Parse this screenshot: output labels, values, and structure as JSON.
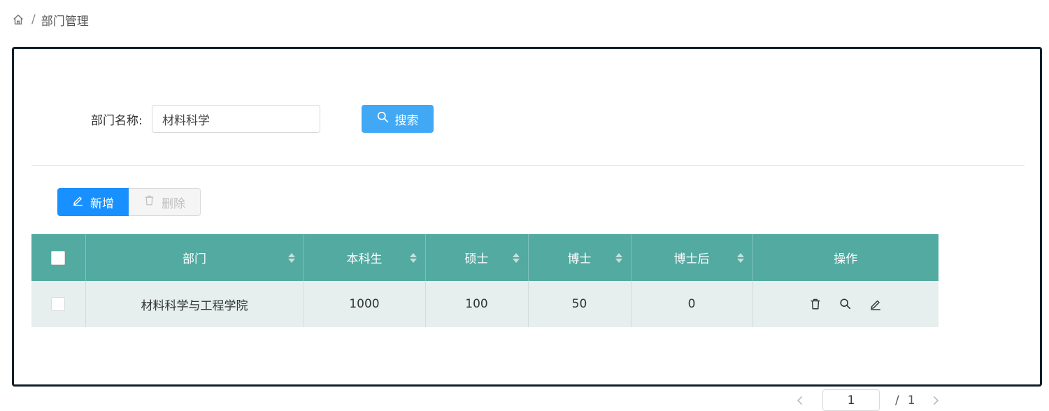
{
  "breadcrumb": {
    "home_icon": "home-icon",
    "separator": "/",
    "current": "部门管理"
  },
  "search": {
    "label": "部门名称:",
    "value": "材料科学",
    "button_label": "搜索",
    "button_color": "#41a8f5"
  },
  "toolbar": {
    "add_label": "新增",
    "delete_label": "删除",
    "add_color": "#1890ff"
  },
  "table": {
    "header_color": "#52aaa1",
    "row_color": "#e6efed",
    "columns": [
      "部门",
      "本科生",
      "硕士",
      "博士",
      "博士后",
      "操作"
    ],
    "rows": [
      {
        "dept": "材料科学与工程学院",
        "undergrad": "1000",
        "master": "100",
        "phd": "50",
        "postdoc": "0",
        "actions": [
          "delete-icon",
          "search-icon",
          "edit-icon"
        ]
      }
    ]
  },
  "pagination": {
    "current": "1",
    "slash": "/",
    "total": "1"
  }
}
